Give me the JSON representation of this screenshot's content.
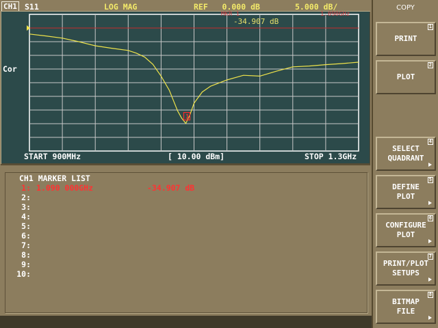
{
  "header": {
    "channel": "CH1",
    "parameter": "S11",
    "format": "LOG MAG",
    "reference": "REF   0.000 dB",
    "scale": "5.000 dB/"
  },
  "display": {
    "correction": "Cor",
    "marker_label": "MKR  1",
    "marker_freq": "1.090GHz",
    "marker_value": "-34.907 dB",
    "start": "START 900MHz",
    "source_power": "[ 10.00 dBm]",
    "stop": "STOP 1.3GHz"
  },
  "colors": {
    "trace": "#f0e44a",
    "marker": "#ff2a2a",
    "reference_line": "#c82c2c",
    "grid": "#c9c9c9",
    "plot_background": "#2c4a4a"
  },
  "chart_data": {
    "type": "line",
    "x_unit": "MHz",
    "y_unit": "dB",
    "xlim": [
      900,
      1300
    ],
    "ylim": [
      -40,
      0
    ],
    "grid": true,
    "series": [
      {
        "x": [
          900,
          920,
          940,
          960,
          980,
          1000,
          1020,
          1030,
          1040,
          1050,
          1060,
          1070,
          1080,
          1085,
          1090,
          1095,
          1100,
          1110,
          1120,
          1140,
          1160,
          1180,
          1200,
          1220,
          1240,
          1260,
          1280,
          1300
        ],
        "y": [
          -2.2,
          -2.9,
          -3.7,
          -5.0,
          -6.5,
          -7.4,
          -8.2,
          -9.2,
          -10.6,
          -13.3,
          -17.6,
          -22.8,
          -30.3,
          -33.0,
          -34.9,
          -31.8,
          -27.5,
          -23.4,
          -21.3,
          -19.0,
          -17.3,
          -17.6,
          -15.8,
          -14.2,
          -13.9,
          -13.4,
          -13.0,
          -12.5
        ]
      }
    ],
    "marker": {
      "label": "1",
      "x": 1090,
      "y": -34.907
    }
  },
  "marker_list": {
    "title": "CH1 MARKER LIST",
    "rows": [
      {
        "num": "1:",
        "freq": "1.090 000GHz",
        "value": "-34.907 dB"
      },
      {
        "num": "2:",
        "freq": "",
        "value": ""
      },
      {
        "num": "3:",
        "freq": "",
        "value": ""
      },
      {
        "num": "4:",
        "freq": "",
        "value": ""
      },
      {
        "num": "5:",
        "freq": "",
        "value": ""
      },
      {
        "num": "6:",
        "freq": "",
        "value": ""
      },
      {
        "num": "7:",
        "freq": "",
        "value": ""
      },
      {
        "num": "8:",
        "freq": "",
        "value": ""
      },
      {
        "num": "9:",
        "freq": "",
        "value": ""
      },
      {
        "num": "10:",
        "freq": "",
        "value": ""
      }
    ]
  },
  "softkeys": {
    "title": "COPY",
    "keys": [
      {
        "line1": "PRINT",
        "line2": "",
        "num": "1"
      },
      {
        "line1": "PLOT",
        "line2": "",
        "num": "2"
      },
      {
        "line1": "SELECT",
        "line2": "QUADRANT",
        "num": "4"
      },
      {
        "line1": "DEFINE",
        "line2": "PLOT",
        "num": "5"
      },
      {
        "line1": "CONFIGURE",
        "line2": "PLOT",
        "num": "6"
      },
      {
        "line1": "PRINT/PLOT",
        "line2": "SETUPS",
        "num": "7"
      },
      {
        "line1": "BITMAP",
        "line2": "FILE",
        "num": "8"
      }
    ]
  }
}
